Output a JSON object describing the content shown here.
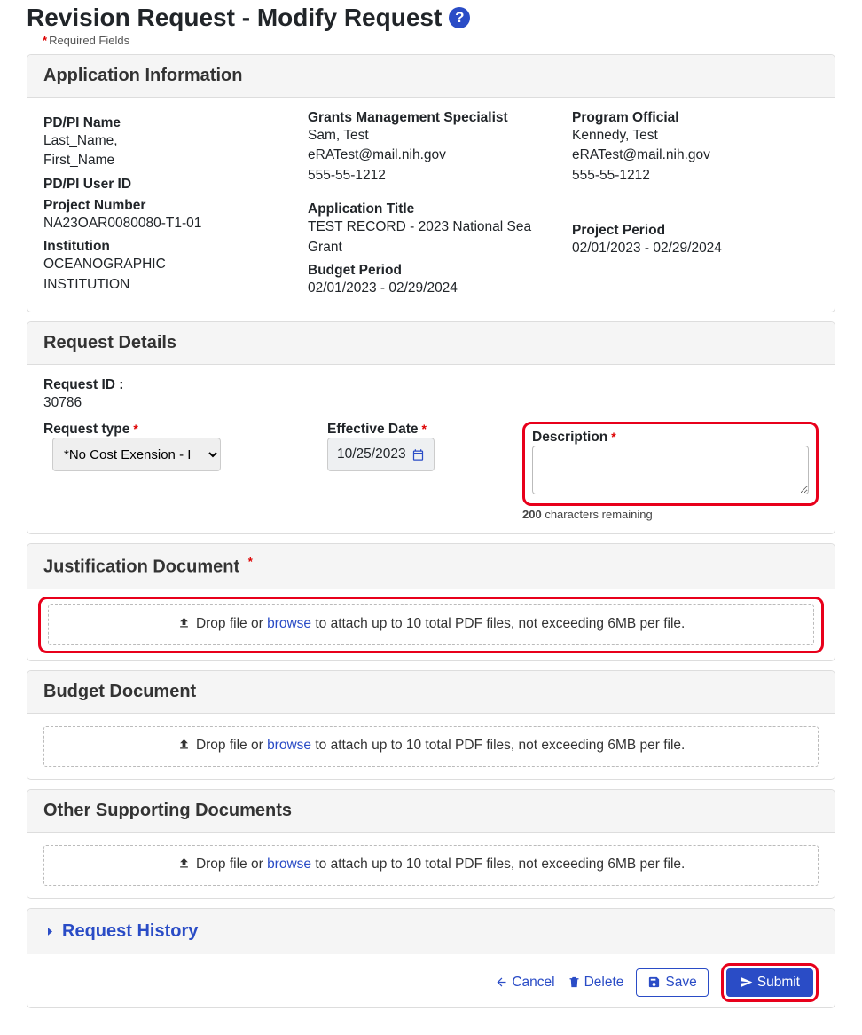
{
  "page": {
    "title": "Revision Request - Modify Request",
    "required_fields": "Required Fields"
  },
  "app_info": {
    "header": "Application Information",
    "pdpi_name_label": "PD/PI Name",
    "pdpi_name_line1": "Last_Name,",
    "pdpi_name_line2": "First_Name",
    "pdpi_userid_label": "PD/PI User ID",
    "project_number_label": "Project Number",
    "project_number": "NA23OAR0080080-T1-01",
    "institution_label": "Institution",
    "institution_line1": "OCEANOGRAPHIC",
    "institution_line2": "INSTITUTION",
    "gms_label": "Grants Management Specialist",
    "gms_name": "Sam, Test",
    "gms_email": "eRATest@mail.nih.gov",
    "gms_phone": "555-55-1212",
    "app_title_label": "Application Title",
    "app_title": "TEST RECORD - 2023 National Sea Grant",
    "budget_label": "Budget Period",
    "budget": "02/01/2023 - 02/29/2024",
    "po_label": "Program Official",
    "po_name": "Kennedy, Test",
    "po_email": "eRATest@mail.nih.gov",
    "po_phone": "555-55-1212",
    "project_period_label": "Project Period",
    "project_period": "02/01/2023 - 02/29/2024"
  },
  "details": {
    "header": "Request Details",
    "request_id_label": "Request ID :",
    "request_id": "30786",
    "request_type_label": "Request type",
    "request_type_value": "*No Cost Exension - I",
    "effective_date_label": "Effective Date",
    "effective_date": "10/25/2023",
    "description_label": "Description",
    "char_count": "200",
    "char_suffix": "characters remaining"
  },
  "justification": {
    "header": "Justification Document",
    "drop_prefix": "Drop file or ",
    "browse": "browse",
    "drop_suffix": " to attach up to 10 total PDF files, not exceeding 6MB per file."
  },
  "budget_doc": {
    "header": "Budget Document",
    "drop_prefix": "Drop file or ",
    "browse": "browse",
    "drop_suffix": " to attach up to 10 total PDF files, not exceeding 6MB per file."
  },
  "other_docs": {
    "header": "Other Supporting Documents",
    "drop_prefix": "Drop file or ",
    "browse": "browse",
    "drop_suffix": " to attach up to 10 total PDF files, not exceeding 6MB per file."
  },
  "history": {
    "header": "Request History"
  },
  "actions": {
    "cancel": "Cancel",
    "delete": "Delete",
    "save": "Save",
    "submit": "Submit"
  }
}
